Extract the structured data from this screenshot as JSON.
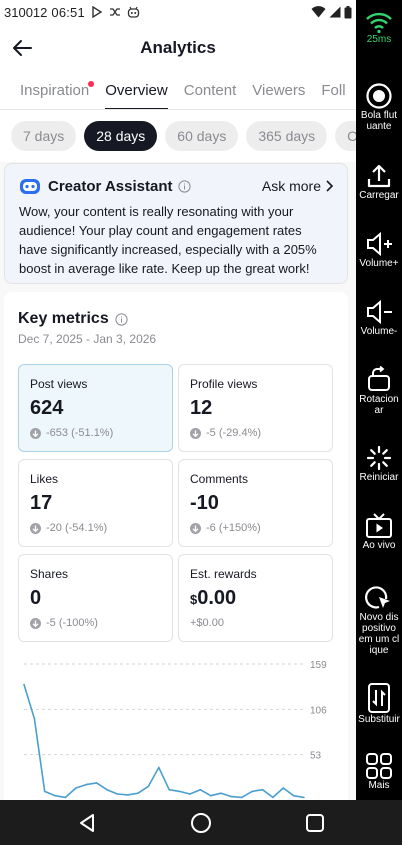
{
  "status_bar": {
    "carrier_id": "310012",
    "time": "06:51"
  },
  "header": {
    "title": "Analytics"
  },
  "tabs": [
    {
      "label": "Inspiration",
      "badge": true
    },
    {
      "label": "Overview",
      "active": true
    },
    {
      "label": "Content"
    },
    {
      "label": "Viewers"
    },
    {
      "label": "Foll"
    }
  ],
  "ranges": [
    {
      "label": "7 days"
    },
    {
      "label": "28 days",
      "active": true
    },
    {
      "label": "60 days"
    },
    {
      "label": "365 days"
    },
    {
      "label": "Cu"
    }
  ],
  "assistant": {
    "title": "Creator Assistant",
    "ask_more": "Ask more",
    "message": "Wow, your content is really resonating with your audience! Your play count and engagement rates have significantly increased, especially with a 205% boost in average like rate. Keep up the great work!"
  },
  "key_metrics": {
    "title": "Key metrics",
    "date_range": "Dec 7, 2025 - Jan 3, 2026",
    "metrics": [
      {
        "label": "Post views",
        "value": "624",
        "change": "-653 (-51.1%)"
      },
      {
        "label": "Profile views",
        "value": "12",
        "change": "-5 (-29.4%)"
      },
      {
        "label": "Likes",
        "value": "17",
        "change": "-20 (-54.1%)"
      },
      {
        "label": "Comments",
        "value": "-10",
        "change": "-6 (+150%)"
      },
      {
        "label": "Shares",
        "value": "0",
        "change": "-5 (-100%)"
      },
      {
        "label": "Est. rewards",
        "currency": "$",
        "value": "0.00",
        "change": "+$0.00"
      }
    ]
  },
  "chart_data": {
    "type": "line",
    "ylim": [
      0,
      159
    ],
    "ytick_labels": [
      "159",
      "106",
      "53"
    ],
    "yticks": [
      159,
      106,
      53
    ],
    "x": [
      1,
      2,
      3,
      4,
      5,
      6,
      7,
      8,
      9,
      10,
      11,
      12,
      13,
      14,
      15,
      16,
      17,
      18,
      19,
      20,
      21,
      22,
      23,
      24,
      25,
      26,
      27,
      28
    ],
    "values": [
      135,
      95,
      10,
      5,
      3,
      14,
      18,
      20,
      12,
      7,
      6,
      8,
      16,
      38,
      12,
      10,
      7,
      12,
      5,
      8,
      4,
      3,
      10,
      12,
      3,
      14,
      5,
      3
    ]
  },
  "side_panel": {
    "ping": "25ms",
    "items": [
      {
        "label": "Bola flut\nuante",
        "icon": "floating-ball-icon"
      },
      {
        "label": "Carregar",
        "icon": "upload-icon"
      },
      {
        "label": "Volume+",
        "icon": "volume-up-icon"
      },
      {
        "label": "Volume-",
        "icon": "volume-down-icon"
      },
      {
        "label": "Rotacion\nar",
        "icon": "rotate-icon"
      },
      {
        "label": "Reiniciar",
        "icon": "restart-icon"
      },
      {
        "label": "Ao vivo",
        "icon": "live-tv-icon"
      },
      {
        "label": "Novo dis\npositivo\nem um cl\nique",
        "icon": "new-device-icon"
      },
      {
        "label": "Substituir",
        "icon": "replace-icon"
      },
      {
        "label": "Mais",
        "icon": "more-grid-icon"
      }
    ]
  },
  "colors": {
    "accent": "#fe2c55",
    "active_metric_border": "#a6d4e6",
    "chart_line": "#4a9fd0",
    "wifi": "#33d66b"
  }
}
